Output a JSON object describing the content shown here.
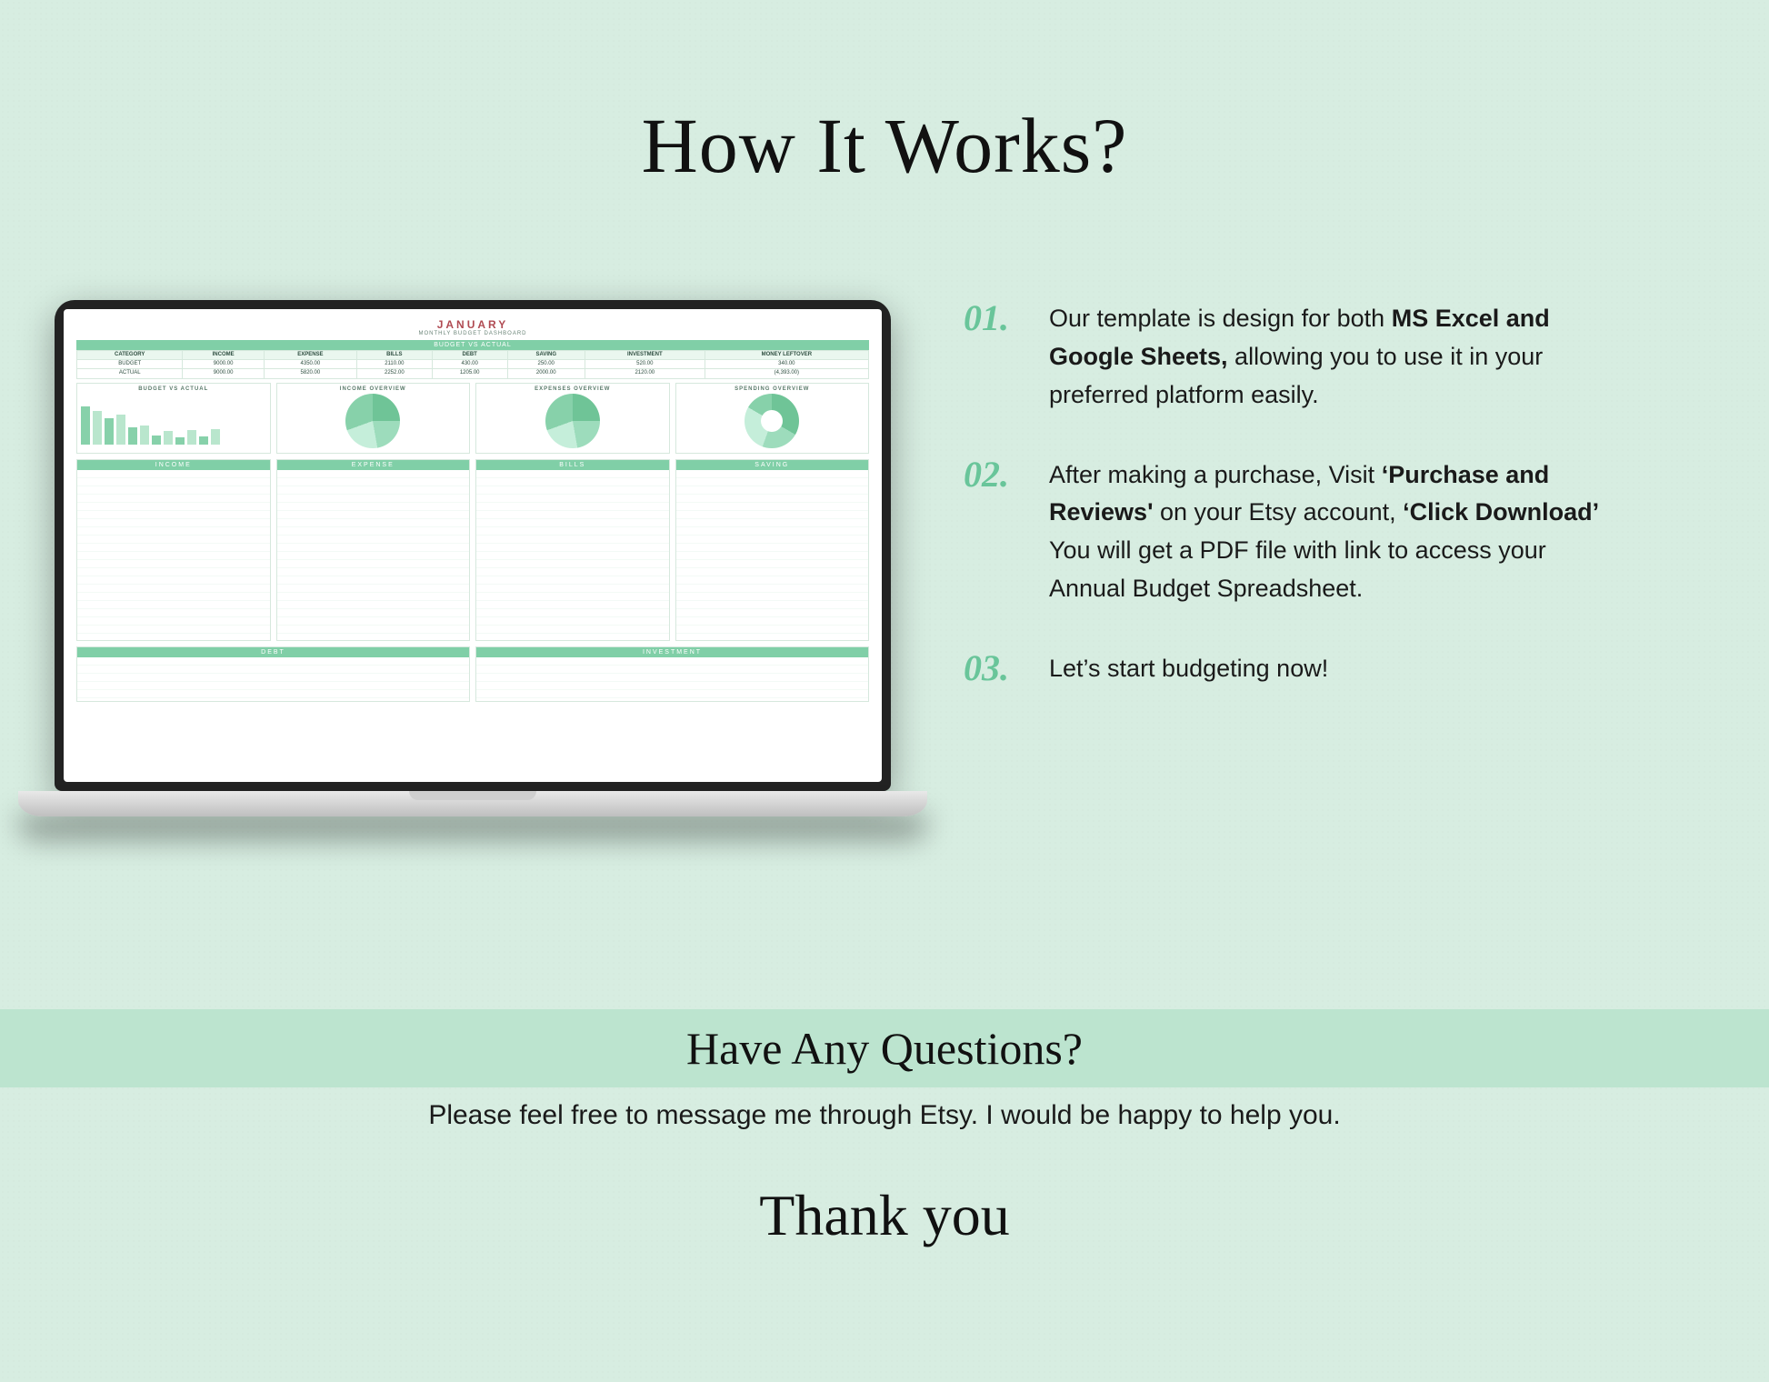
{
  "title": "How It Works?",
  "laptop": {
    "dashboard_title": "JANUARY",
    "dashboard_subtitle": "MONTHLY BUDGET DASHBOARD",
    "section_header": "BUDGET VS ACTUAL",
    "table": {
      "headers": [
        "CATEGORY",
        "INCOME",
        "EXPENSE",
        "BILLS",
        "DEBT",
        "SAVING",
        "INVESTMENT",
        "MONEY LEFTOVER"
      ],
      "rows": [
        [
          "BUDGET",
          "9000.00",
          "4350.00",
          "2110.00",
          "430.00",
          "250.00",
          "520.00",
          "340.00"
        ],
        [
          "ACTUAL",
          "9000.00",
          "5820.00",
          "2252.00",
          "1205.00",
          "2000.00",
          "2120.00",
          "(4,393.00)"
        ]
      ]
    },
    "charts": {
      "c1": "BUDGET VS ACTUAL",
      "c2": "INCOME OVERVIEW",
      "c3": "EXPENSES OVERVIEW",
      "c4": "SPENDING OVERVIEW"
    },
    "panels": {
      "p1": "INCOME",
      "p2": "EXPENSE",
      "p3": "BILLS",
      "p4": "SAVING"
    },
    "bottom": {
      "b1": "DEBT",
      "b2": "INVESTMENT"
    }
  },
  "steps": [
    {
      "num": "01.",
      "pre": "Our template is design  for both ",
      "bold1": "MS Excel and Google Sheets,",
      "post1": " allowing you to use it in your preferred platform easily."
    },
    {
      "num": "02.",
      "pre": "After making a purchase, Visit ",
      "bold1": "‘Purchase and Reviews'",
      "mid": " on your Etsy account, ",
      "bold2": "‘Click Download’",
      "post1": " You will get a PDF file with link to access your Annual Budget Spreadsheet."
    },
    {
      "num": "03.",
      "pre": "Let’s start budgeting now!"
    }
  ],
  "footer": {
    "heading": "Have Any Questions?",
    "message": "Please feel free to message me through Etsy. I would be happy to help you.",
    "thanks": "Thank you"
  }
}
